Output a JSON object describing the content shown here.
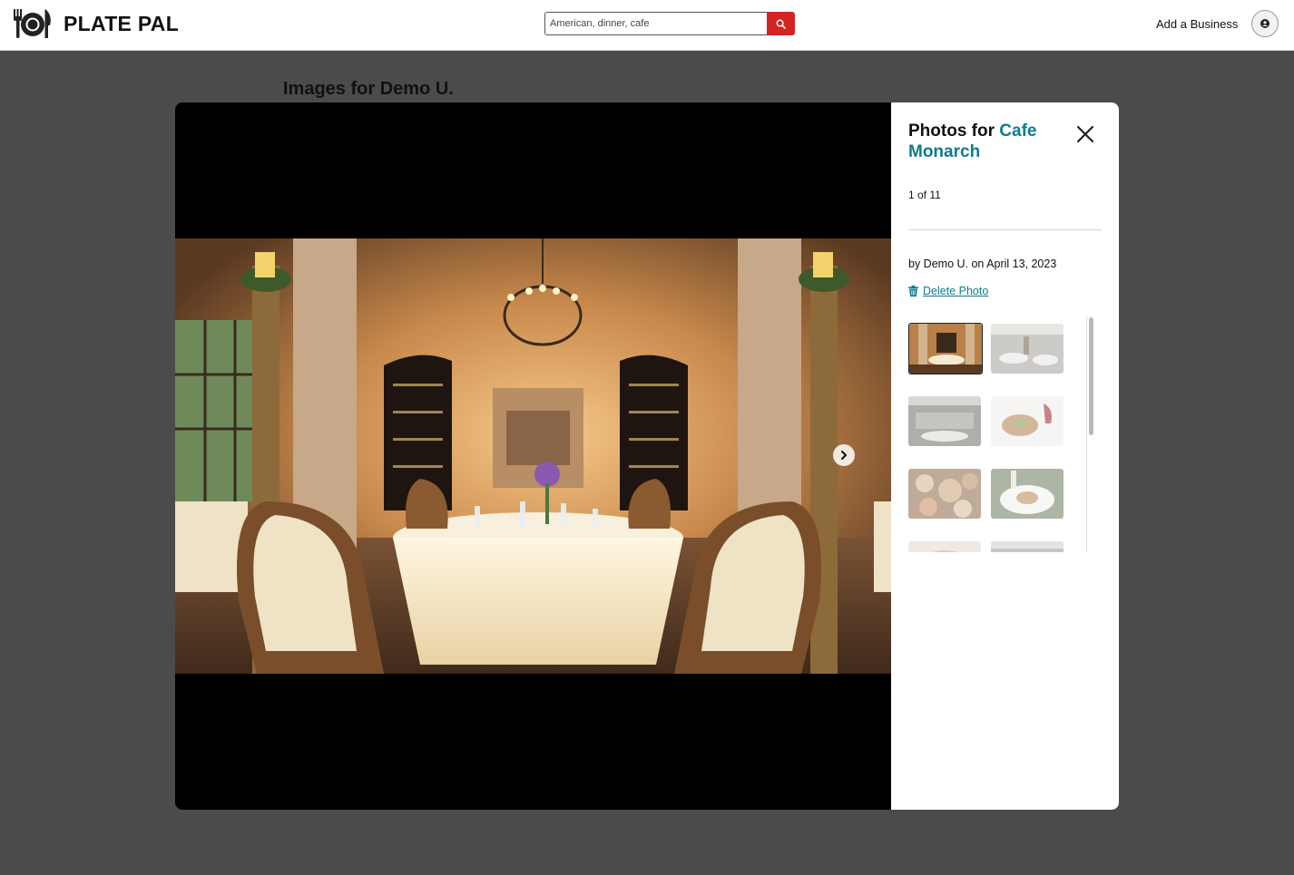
{
  "header": {
    "app_name": "PLATE PAL",
    "logo_icon": "plate-fork-knife-icon",
    "search_placeholder": "American, dinner, cafe",
    "search_icon": "search-icon",
    "add_business_label": "Add a Business",
    "avatar_icon": "user-avatar-icon"
  },
  "page": {
    "heading": "Images for Demo U."
  },
  "modal": {
    "title_prefix": "Photos for ",
    "business_name": "Cafe Monarch",
    "counter": "1 of 11",
    "byline": "by Demo U. on April 13, 2023",
    "delete_label": "Delete Photo",
    "close_icon": "close-icon",
    "next_icon": "chevron-right-icon",
    "accent_color": "#0d7c8c",
    "thumbnails": [
      {
        "subject": "dining room with chandelier",
        "selected": true
      },
      {
        "subject": "dining room",
        "selected": false
      },
      {
        "subject": "restaurant interior",
        "selected": false
      },
      {
        "subject": "plated dish with red wine",
        "selected": false
      },
      {
        "subject": "table of dishes",
        "selected": false
      },
      {
        "subject": "plated entree with wine",
        "selected": false
      },
      {
        "subject": "partially visible photo",
        "selected": false
      },
      {
        "subject": "partially visible photo",
        "selected": false
      }
    ]
  },
  "colors": {
    "brand_red": "#d32323",
    "overlay": "#4b4b4b"
  }
}
